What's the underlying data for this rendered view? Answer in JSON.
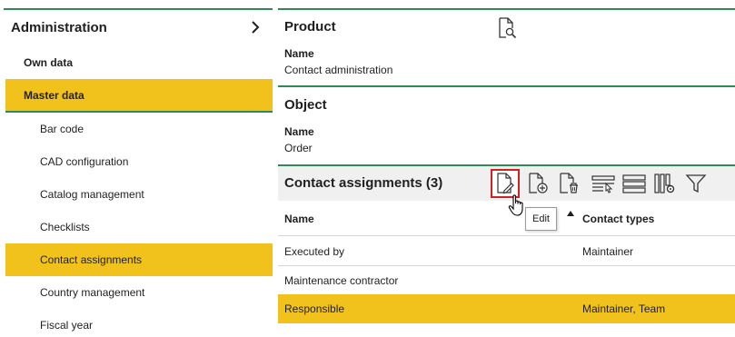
{
  "sidebar": {
    "title": "Administration",
    "items": [
      {
        "label": "Own data"
      },
      {
        "label": "Master data"
      },
      {
        "label": "Bar code"
      },
      {
        "label": "CAD configuration"
      },
      {
        "label": "Catalog management"
      },
      {
        "label": "Checklists"
      },
      {
        "label": "Contact assignments"
      },
      {
        "label": "Country management"
      },
      {
        "label": "Fiscal year"
      }
    ]
  },
  "product": {
    "title": "Product",
    "name_label": "Name",
    "name_value": "Contact administration"
  },
  "object": {
    "title": "Object",
    "name_label": "Name",
    "name_value": "Order"
  },
  "contact_assignments": {
    "title": "Contact assignments (3)",
    "toolbar_icons": [
      "edit-icon",
      "add-icon",
      "delete-icon",
      "select-columns-icon",
      "rows-icon",
      "columns-settings-icon",
      "filter-icon"
    ],
    "tooltip": "Edit",
    "columns": [
      "Name",
      "Contact types"
    ],
    "rows": [
      {
        "name": "Executed by",
        "contact_types": "Maintainer"
      },
      {
        "name": "Maintenance contractor",
        "contact_types": ""
      },
      {
        "name": "Responsible",
        "contact_types": "Maintainer, Team"
      }
    ]
  },
  "colors": {
    "accent_green": "#2e8b57",
    "highlight_yellow": "#f1c21b",
    "active_border_red": "#d42020"
  }
}
